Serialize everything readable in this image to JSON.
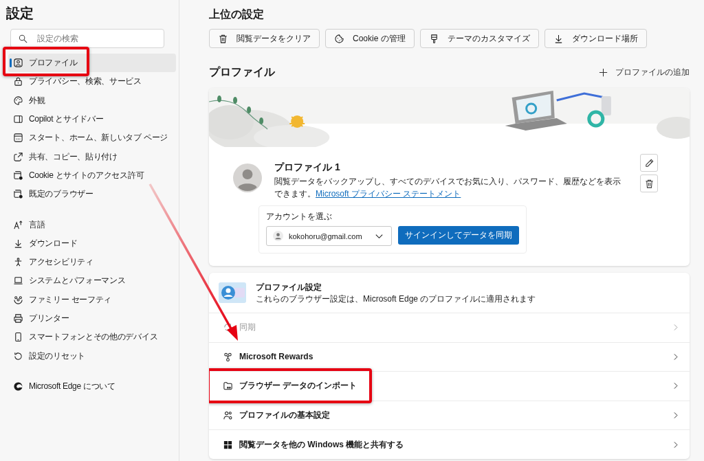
{
  "sidebar": {
    "title": "設定",
    "search": {
      "placeholder": "設定の検索"
    },
    "groups": [
      [
        {
          "label": "プロファイル",
          "selected": true,
          "highlighted": true
        },
        {
          "label": "プライバシー、検索、サービス",
          "selected": false,
          "highlighted": false
        },
        {
          "label": "外観",
          "selected": false,
          "highlighted": false
        },
        {
          "label": "Copilot とサイドバー",
          "selected": false,
          "highlighted": false
        },
        {
          "label": "スタート、ホーム、新しいタブ ページ",
          "selected": false,
          "highlighted": false
        },
        {
          "label": "共有、コピー、貼り付け",
          "selected": false,
          "highlighted": false
        },
        {
          "label": "Cookie とサイトのアクセス許可",
          "selected": false,
          "highlighted": false
        },
        {
          "label": "既定のブラウザー",
          "selected": false,
          "highlighted": false
        }
      ],
      [
        {
          "label": "言語",
          "selected": false,
          "highlighted": false
        },
        {
          "label": "ダウンロード",
          "selected": false,
          "highlighted": false
        },
        {
          "label": "アクセシビリティ",
          "selected": false,
          "highlighted": false
        },
        {
          "label": "システムとパフォーマンス",
          "selected": false,
          "highlighted": false
        },
        {
          "label": "ファミリー セーフティ",
          "selected": false,
          "highlighted": false
        },
        {
          "label": "プリンター",
          "selected": false,
          "highlighted": false
        },
        {
          "label": "スマートフォンとその他のデバイス",
          "selected": false,
          "highlighted": false
        },
        {
          "label": "設定のリセット",
          "selected": false,
          "highlighted": false
        }
      ],
      [
        {
          "label": "Microsoft Edge について",
          "selected": false,
          "highlighted": false
        }
      ]
    ]
  },
  "top_settings": {
    "title": "上位の設定",
    "buttons": [
      "閲覧データをクリア",
      "Cookie の管理",
      "テーマのカスタマイズ",
      "ダウンロード場所"
    ]
  },
  "profile_section": {
    "title": "プロファイル",
    "add_button": "プロファイルの追加",
    "profile": {
      "name": "プロファイル 1",
      "description": "閲覧データをバックアップし、すべてのデバイスでお気に入り、パスワード、履歴などを表示できます。",
      "link": "Microsoft プライバシー ステートメント"
    },
    "account": {
      "label": "アカウントを選ぶ",
      "value": "kokohoru@gmail.com",
      "sync_button": "サインインしてデータを同期"
    }
  },
  "profile_settings": {
    "title": "プロファイル設定",
    "subtitle": "これらのブラウザー設定は、Microsoft Edge のプロファイルに適用されます",
    "rows": [
      {
        "label": "同期",
        "disabled": true,
        "highlighted": false
      },
      {
        "label": "Microsoft Rewards",
        "disabled": false,
        "highlighted": false
      },
      {
        "label": "ブラウザー データのインポート",
        "disabled": false,
        "highlighted": true
      },
      {
        "label": "プロファイルの基本設定",
        "disabled": false,
        "highlighted": false
      },
      {
        "label": "閲覧データを他の Windows 機能と共有する",
        "disabled": false,
        "highlighted": false
      }
    ]
  },
  "annotation": {
    "arrow": true
  }
}
